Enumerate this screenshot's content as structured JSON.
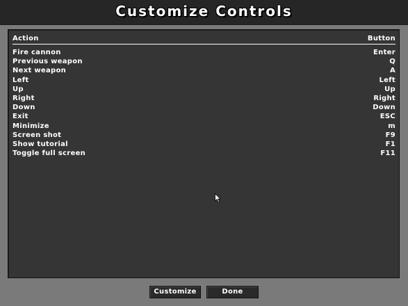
{
  "window": {
    "title": "Customize Controls"
  },
  "table": {
    "headers": {
      "action": "Action",
      "button": "Button"
    },
    "rows": [
      {
        "action": "Fire cannon",
        "button": "Enter"
      },
      {
        "action": "Previous weapon",
        "button": "Q"
      },
      {
        "action": "Next weapon",
        "button": "A"
      },
      {
        "action": "Left",
        "button": "Left"
      },
      {
        "action": "Up",
        "button": "Up"
      },
      {
        "action": "Right",
        "button": "Right"
      },
      {
        "action": "Down",
        "button": "Down"
      },
      {
        "action": "Exit",
        "button": "ESC"
      },
      {
        "action": "Minimize",
        "button": "m"
      },
      {
        "action": "Screen shot",
        "button": "F9"
      },
      {
        "action": "Show tutorial",
        "button": "F1"
      },
      {
        "action": "Toggle full screen",
        "button": "F11"
      }
    ]
  },
  "footer": {
    "customize_label": "Customize",
    "done_label": "Done"
  },
  "colors": {
    "background": "#7a7a7a",
    "panel": "#353535",
    "title_bar": "#262626",
    "text": "#ffffff"
  },
  "icons": {
    "cursor": "mouse-pointer-icon"
  }
}
